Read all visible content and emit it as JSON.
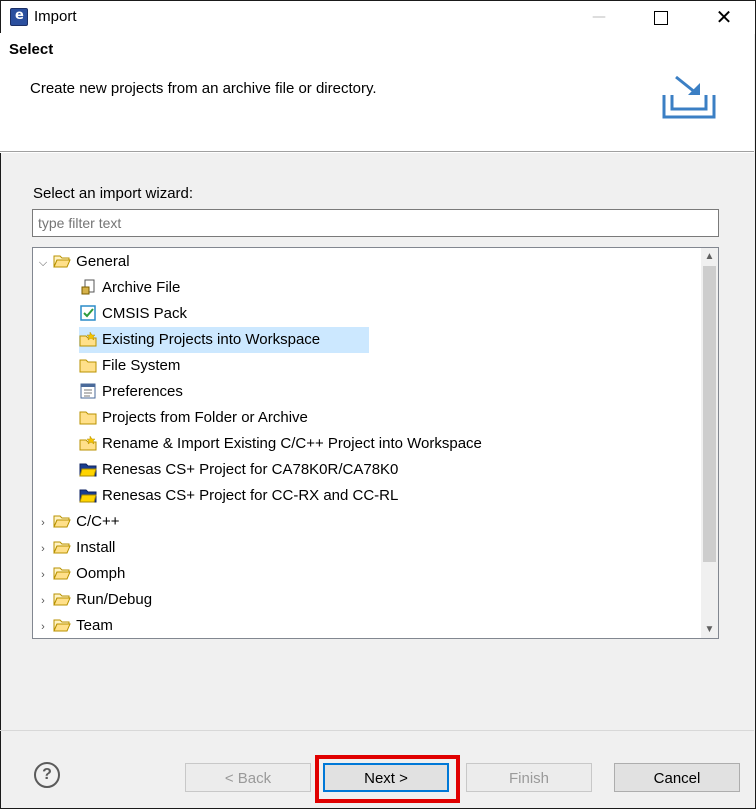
{
  "window": {
    "title": "Import"
  },
  "header": {
    "title": "Select",
    "description": "Create new projects from an archive file or directory."
  },
  "wizard": {
    "label": "Select an import wizard:",
    "filter_placeholder": "type filter text"
  },
  "tree": {
    "general": "General",
    "general_items": [
      "Archive File",
      "CMSIS Pack",
      "Existing Projects into Workspace",
      "File System",
      "Preferences",
      "Projects from Folder or Archive",
      "Rename & Import Existing C/C++ Project into Workspace",
      "Renesas CS+ Project for CA78K0R/CA78K0",
      "Renesas CS+ Project for CC-RX and CC-RL"
    ],
    "collapsed": [
      "C/C++",
      "Install",
      "Oomph",
      "Run/Debug",
      "Team"
    ],
    "selected": "Existing Projects into Workspace"
  },
  "buttons": {
    "help": "?",
    "back": "< Back",
    "next": "Next >",
    "finish": "Finish",
    "cancel": "Cancel"
  }
}
